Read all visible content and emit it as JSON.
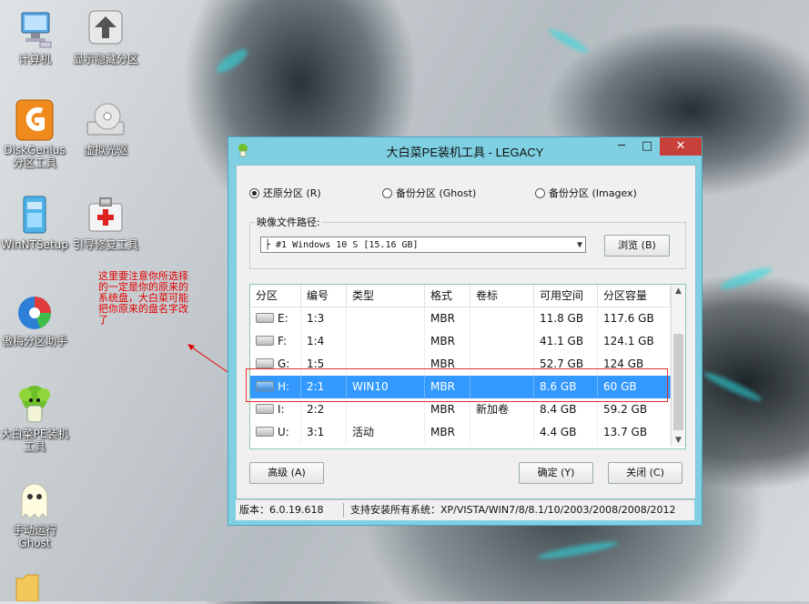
{
  "desktop": {
    "icons": [
      {
        "label": "计算机"
      },
      {
        "label": "显示隐藏分区"
      },
      {
        "label": "DiskGenius\n分区工具"
      },
      {
        "label": "虚拟光驱"
      },
      {
        "label": "WinNTSetup"
      },
      {
        "label": "引导修复工具"
      },
      {
        "label": "傲梅分区助手"
      },
      {
        "label": "大白菜PE装机\n工具"
      },
      {
        "label": "手动运行\nGhost"
      }
    ],
    "annotation": "这里要注意你所选择的一定是你的原来的系统盘，大白菜可能把你原来的盘名字改了",
    "colors": {
      "annotation": "#e00000",
      "highlight_box": "#e03030"
    }
  },
  "window": {
    "title": "大白菜PE装机工具 - LEGACY",
    "controls": {
      "minimize": "─",
      "maximize": "□",
      "close": "✕"
    },
    "radios": {
      "restore": "还原分区 (R)",
      "backup_ghost": "备份分区 (Ghost)",
      "backup_imagex": "备份分区 (Imagex)"
    },
    "image_path_label": "映像文件路径:",
    "image_combo_value": "├ #1 Windows 10 S [15.16 GB]",
    "browse_button": "浏览 (B)",
    "table": {
      "headers": [
        "分区",
        "编号",
        "类型",
        "格式",
        "卷标",
        "可用空间",
        "分区容量"
      ],
      "rows": [
        {
          "drive": "E:",
          "num": "1:3",
          "type": "",
          "fmt": "MBR",
          "label": "",
          "free": "11.8 GB",
          "cap": "117.6 GB",
          "selected": false
        },
        {
          "drive": "F:",
          "num": "1:4",
          "type": "",
          "fmt": "MBR",
          "label": "",
          "free": "41.1 GB",
          "cap": "124.1 GB",
          "selected": false
        },
        {
          "drive": "G:",
          "num": "1:5",
          "type": "",
          "fmt": "MBR",
          "label": "",
          "free": "52.7 GB",
          "cap": "124 GB",
          "selected": false
        },
        {
          "drive": "H:",
          "num": "2:1",
          "type": "WIN10",
          "fmt": "MBR",
          "label": "",
          "free": "8.6 GB",
          "cap": "60 GB",
          "selected": true
        },
        {
          "drive": "I:",
          "num": "2:2",
          "type": "",
          "fmt": "MBR",
          "label": "新加卷",
          "free": "8.4 GB",
          "cap": "59.2 GB",
          "selected": false
        },
        {
          "drive": "U:",
          "num": "3:1",
          "type": "活动",
          "fmt": "MBR",
          "label": "",
          "free": "4.4 GB",
          "cap": "13.7 GB",
          "selected": false
        }
      ]
    },
    "buttons": {
      "advanced": "高级 (A)",
      "ok": "确定 (Y)",
      "close": "关闭 (C)"
    },
    "status": {
      "version": "版本：6.0.19.618",
      "support": "支持安装所有系统：XP/VISTA/WIN7/8/8.1/10/2003/2008/2008/2012"
    },
    "colors": {
      "frame": "#7ed0e2",
      "selection": "#3399ff",
      "close_button": "#c7403a"
    }
  }
}
